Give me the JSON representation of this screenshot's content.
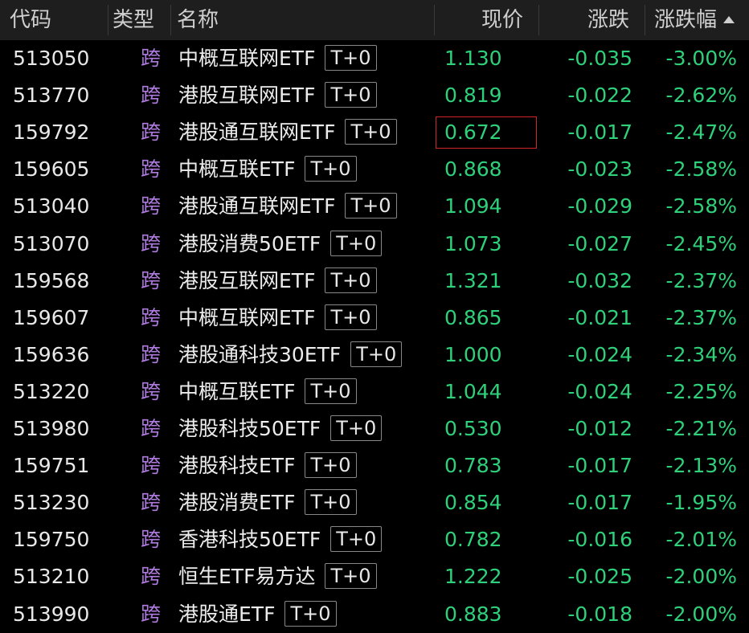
{
  "header": {
    "code": "代码",
    "type": "类型",
    "name": "名称",
    "price": "现价",
    "change": "涨跌",
    "change_pct": "涨跌幅"
  },
  "colors": {
    "down": "#2fd07a",
    "type_tag": "#b07be0",
    "selection": "#d0242a"
  },
  "selected_row": 2,
  "rows": [
    {
      "code": "513050",
      "type": "跨",
      "name": "中概互联网ETF",
      "tag": "T+0",
      "price": "1.130",
      "change": "-0.035",
      "change_pct": "-3.00%"
    },
    {
      "code": "513770",
      "type": "跨",
      "name": "港股互联网ETF",
      "tag": "T+0",
      "price": "0.819",
      "change": "-0.022",
      "change_pct": "-2.62%"
    },
    {
      "code": "159792",
      "type": "跨",
      "name": "港股通互联网ETF",
      "tag": "T+0",
      "price": "0.672",
      "change": "-0.017",
      "change_pct": "-2.47%"
    },
    {
      "code": "159605",
      "type": "跨",
      "name": "中概互联ETF",
      "tag": "T+0",
      "price": "0.868",
      "change": "-0.023",
      "change_pct": "-2.58%"
    },
    {
      "code": "513040",
      "type": "跨",
      "name": "港股通互联网ETF",
      "tag": "T+0",
      "price": "1.094",
      "change": "-0.029",
      "change_pct": "-2.58%"
    },
    {
      "code": "513070",
      "type": "跨",
      "name": "港股消费50ETF",
      "tag": "T+0",
      "price": "1.073",
      "change": "-0.027",
      "change_pct": "-2.45%"
    },
    {
      "code": "159568",
      "type": "跨",
      "name": "港股互联网ETF",
      "tag": "T+0",
      "price": "1.321",
      "change": "-0.032",
      "change_pct": "-2.37%"
    },
    {
      "code": "159607",
      "type": "跨",
      "name": "中概互联网ETF",
      "tag": "T+0",
      "price": "0.865",
      "change": "-0.021",
      "change_pct": "-2.37%"
    },
    {
      "code": "159636",
      "type": "跨",
      "name": "港股通科技30ETF",
      "tag": "T+0",
      "price": "1.000",
      "change": "-0.024",
      "change_pct": "-2.34%"
    },
    {
      "code": "513220",
      "type": "跨",
      "name": "中概互联ETF",
      "tag": "T+0",
      "price": "1.044",
      "change": "-0.024",
      "change_pct": "-2.25%"
    },
    {
      "code": "513980",
      "type": "跨",
      "name": "港股科技50ETF",
      "tag": "T+0",
      "price": "0.530",
      "change": "-0.012",
      "change_pct": "-2.21%"
    },
    {
      "code": "159751",
      "type": "跨",
      "name": "港股科技ETF",
      "tag": "T+0",
      "price": "0.783",
      "change": "-0.017",
      "change_pct": "-2.13%"
    },
    {
      "code": "513230",
      "type": "跨",
      "name": "港股消费ETF",
      "tag": "T+0",
      "price": "0.854",
      "change": "-0.017",
      "change_pct": "-1.95%"
    },
    {
      "code": "159750",
      "type": "跨",
      "name": "香港科技50ETF",
      "tag": "T+0",
      "price": "0.782",
      "change": "-0.016",
      "change_pct": "-2.01%"
    },
    {
      "code": "513210",
      "type": "跨",
      "name": "恒生ETF易方达",
      "tag": "T+0",
      "price": "1.222",
      "change": "-0.025",
      "change_pct": "-2.00%"
    },
    {
      "code": "513990",
      "type": "跨",
      "name": "港股通ETF",
      "tag": "T+0",
      "price": "0.883",
      "change": "-0.018",
      "change_pct": "-2.00%"
    }
  ]
}
